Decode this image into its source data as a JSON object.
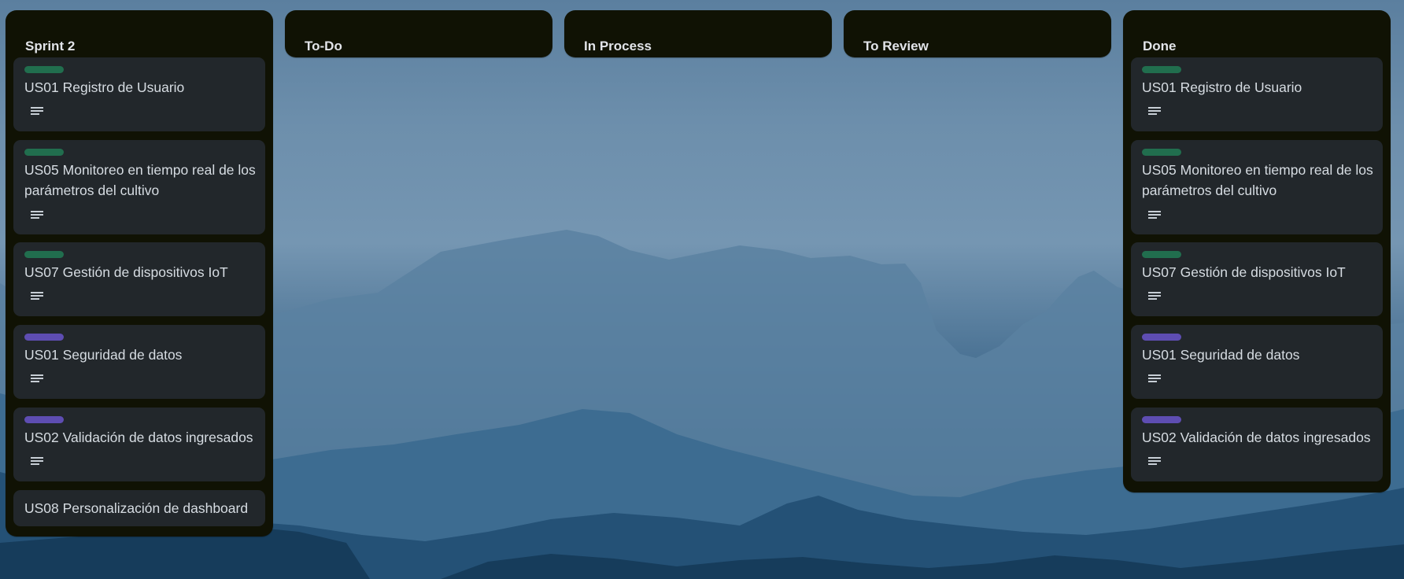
{
  "colors": {
    "list_bg": "#101204",
    "card_bg": "#22272b",
    "label_green": "#216e4e",
    "label_purple": "#5e4db2"
  },
  "lists": [
    {
      "title": "Sprint 2",
      "cards": [
        {
          "title": "US01 Registro de Usuario",
          "label": "green",
          "description_icon": "description-icon"
        },
        {
          "title": "US05 Monitoreo en tiempo real de los parámetros del cultivo",
          "label": "green",
          "description_icon": "description-icon"
        },
        {
          "title": "US07 Gestión de dispositivos IoT",
          "label": "green",
          "description_icon": "description-icon"
        },
        {
          "title": "US01 Seguridad de datos",
          "label": "purple",
          "description_icon": "description-icon"
        },
        {
          "title": "US02 Validación de datos ingresados",
          "label": "purple",
          "description_icon": "description-icon"
        },
        {
          "title": "US08 Personalización de dashboard"
        }
      ]
    },
    {
      "title": "To-Do",
      "cards": []
    },
    {
      "title": "In Process",
      "cards": []
    },
    {
      "title": "To Review",
      "cards": []
    },
    {
      "title": "Done",
      "cards": [
        {
          "title": "US01 Registro de Usuario",
          "label": "green",
          "description_icon": "description-icon"
        },
        {
          "title": "US05 Monitoreo en tiempo real de los parámetros del cultivo",
          "label": "green",
          "description_icon": "description-icon"
        },
        {
          "title": "US07 Gestión de dispositivos IoT",
          "label": "green",
          "description_icon": "description-icon"
        },
        {
          "title": "US01 Seguridad de datos",
          "label": "purple",
          "description_icon": "description-icon"
        },
        {
          "title": "US02 Validación de datos ingresados",
          "label": "purple",
          "description_icon": "description-icon"
        }
      ]
    }
  ]
}
